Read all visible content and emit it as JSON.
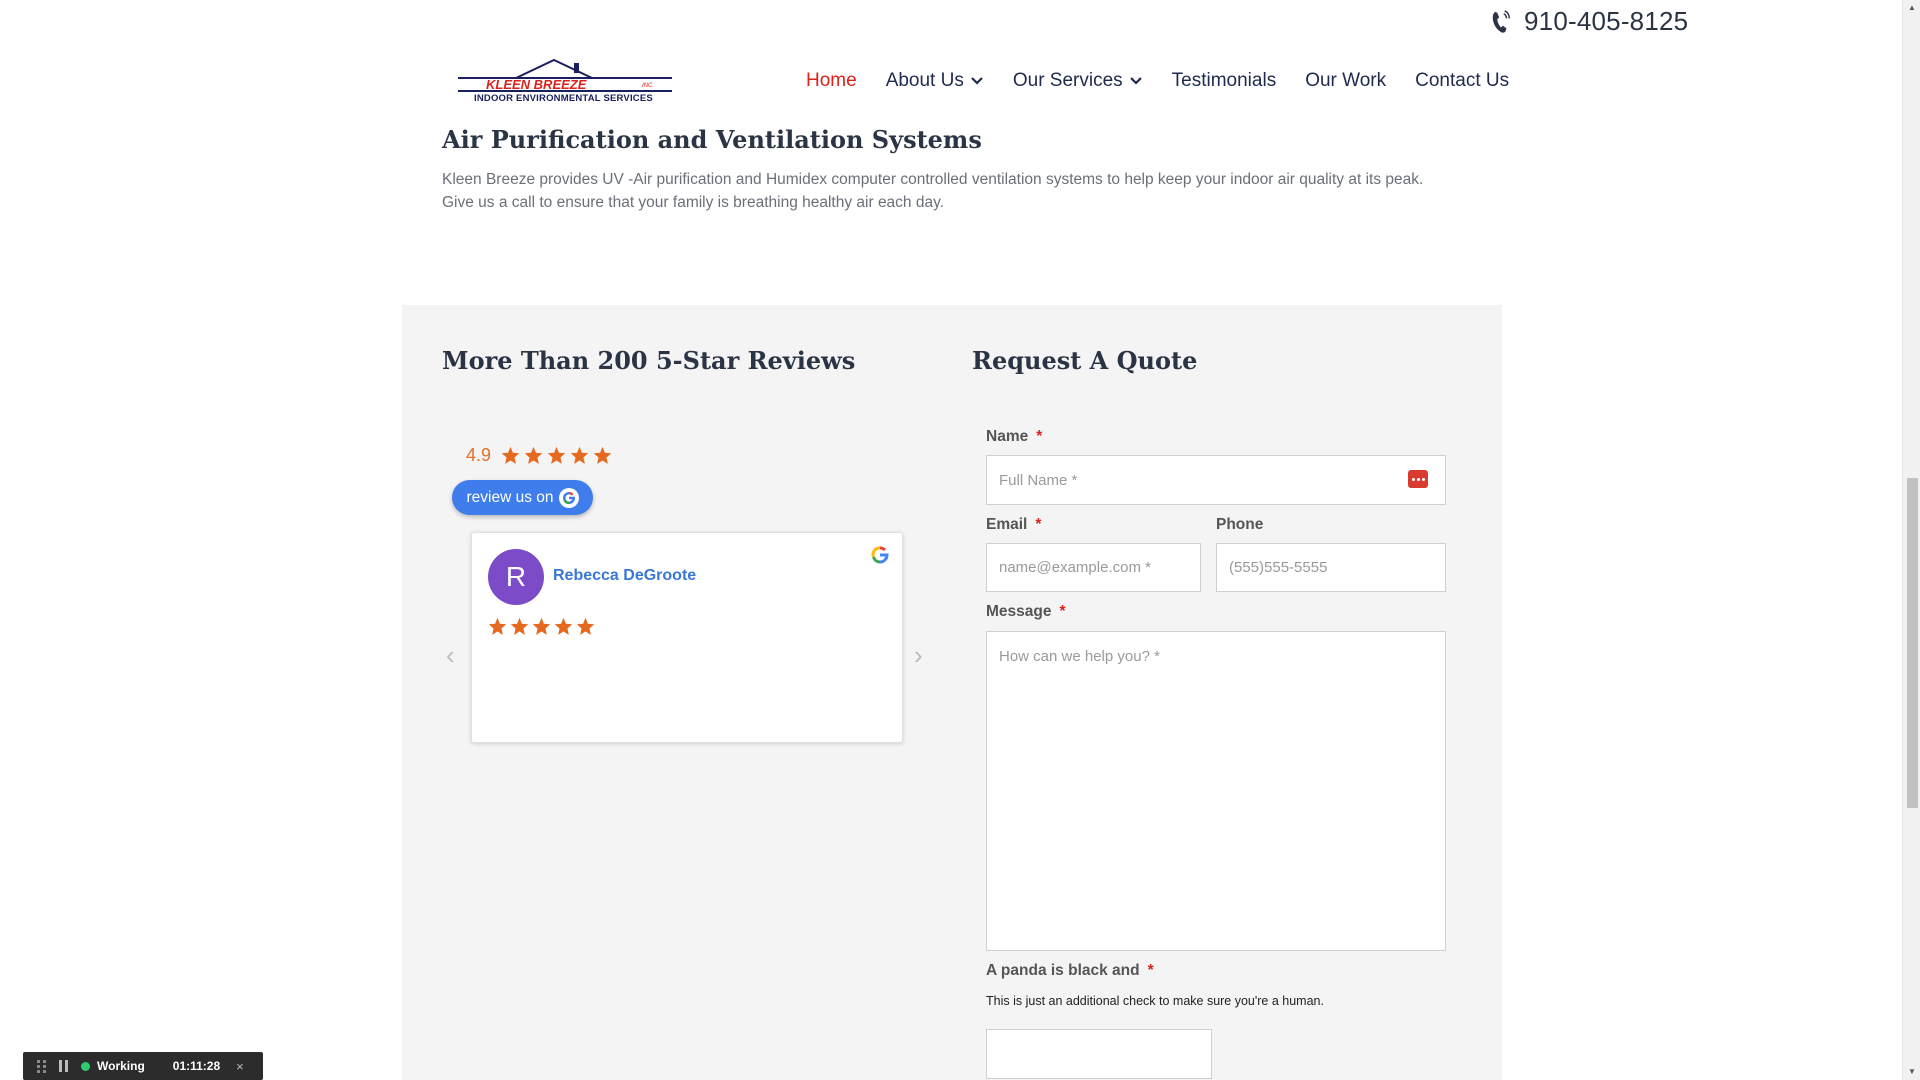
{
  "header": {
    "phone": "910-405-8125",
    "logo_text": "KLEEN BREEZE",
    "logo_inc": "INC.",
    "logo_subtitle": "INDOOR ENVIRONMENTAL SERVICES"
  },
  "nav": {
    "items": [
      {
        "label": "Home",
        "active": true,
        "dropdown": false
      },
      {
        "label": "About Us",
        "active": false,
        "dropdown": true
      },
      {
        "label": "Our Services",
        "active": false,
        "dropdown": true
      },
      {
        "label": "Testimonials",
        "active": false,
        "dropdown": false
      },
      {
        "label": "Our Work",
        "active": false,
        "dropdown": false
      },
      {
        "label": "Contact Us",
        "active": false,
        "dropdown": false
      }
    ]
  },
  "intro": {
    "title": "Air Purification and Ventilation Systems",
    "line1": "Kleen Breeze provides UV -Air purification and Humidex computer controlled ventilation systems to help keep your indoor air quality at its peak.",
    "line2": "Give us a call to ensure that your family is breathing healthy air each day."
  },
  "reviews": {
    "title": "More Than 200 5-Star Reviews",
    "rating": "4.9",
    "rating_stars": 5,
    "review_button": "review us on",
    "card": {
      "avatar_initial": "R",
      "reviewer": "Rebecca DeGroote",
      "stars": 5
    },
    "prev_arrow": "‹",
    "next_arrow": "›"
  },
  "quote": {
    "title": "Request A Quote",
    "name_label": "Name",
    "name_placeholder": "Full Name *",
    "email_label": "Email",
    "email_placeholder": "name@example.com *",
    "phone_label": "Phone",
    "phone_placeholder": "(555)555-5555",
    "message_label": "Message",
    "message_placeholder": "How can we help you? *",
    "captcha_label": "A panda is black and",
    "captcha_help": "This is just an additional check to make sure you're a human.",
    "required_mark": "*"
  },
  "recorder": {
    "status": "Working",
    "time": "01:11:28",
    "close": "×"
  },
  "colors": {
    "accent_red": "#d9231d",
    "nav_text": "#1f2a4c",
    "band_bg": "#f4f4f4",
    "star_orange": "#e56a1f",
    "google_blue": "#3f7ded",
    "avatar_purple": "#7b4bc8"
  }
}
